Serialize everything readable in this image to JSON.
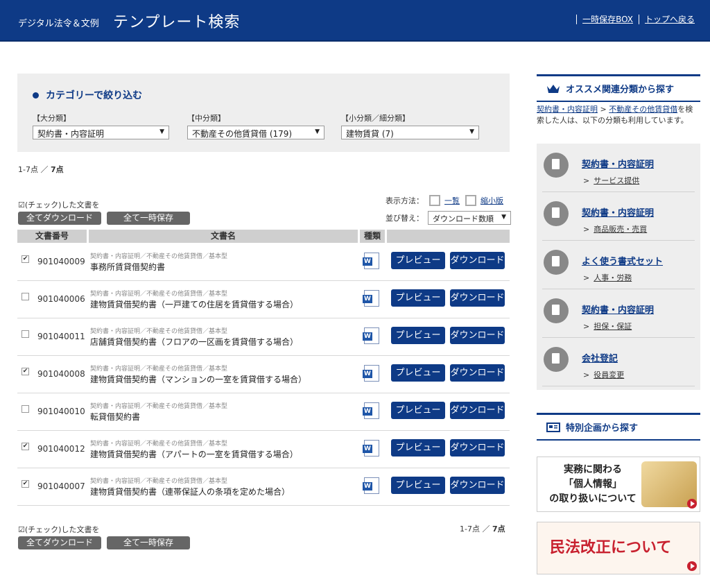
{
  "header": {
    "brand": "デジタル法令＆文例",
    "title": "テンプレート検索",
    "links": [
      "一時保存BOX",
      "トップへ戻る"
    ]
  },
  "filter": {
    "title": "カテゴリーで絞り込む",
    "large": {
      "label": "【大分類】",
      "value": "契約書・内容証明"
    },
    "middle": {
      "label": "【中分類】",
      "value": "不動産その他賃貸借 (179)"
    },
    "small": {
      "label": "【小分類／細分類】",
      "value": "建物賃貸 (7)"
    }
  },
  "count": {
    "range": "1-7点",
    "sep": "／",
    "total": "7点"
  },
  "list": {
    "check_note": "☑(チェック)した文書を",
    "download_all": "全てダウンロード",
    "save_all": "全て一時保存",
    "display_label": "表示方法：",
    "mode_list": "一覧",
    "mode_thumb": "縮小版",
    "sort_label": "並び替え：",
    "sort_value": "ダウンロード数順",
    "headers": {
      "no": "文書番号",
      "name": "文書名",
      "type": "種類"
    },
    "preview_label": "プレビュー",
    "download_label": "ダウンロード",
    "rows": [
      {
        "checked": "✔",
        "no": "901040009",
        "cat": "契約書・内容証明／不動産その他賃貸借／基本型",
        "name": "事務所賃貸借契約書"
      },
      {
        "checked": "",
        "no": "901040006",
        "cat": "契約書・内容証明／不動産その他賃貸借／基本型",
        "name": "建物賃貸借契約書（一戸建ての住居を賃貸借する場合）"
      },
      {
        "checked": "",
        "no": "901040011",
        "cat": "契約書・内容証明／不動産その他賃貸借／基本型",
        "name": "店舗賃貸借契約書（フロアの一区画を賃貸借する場合）"
      },
      {
        "checked": "✔",
        "no": "901040008",
        "cat": "契約書・内容証明／不動産その他賃貸借／基本型",
        "name": "建物賃貸借契約書（マンションの一室を賃貸借する場合）"
      },
      {
        "checked": "",
        "no": "901040010",
        "cat": "契約書・内容証明／不動産その他賃貸借／基本型",
        "name": "転貸借契約書"
      },
      {
        "checked": "✔",
        "no": "901040012",
        "cat": "契約書・内容証明／不動産その他賃貸借／基本型",
        "name": "建物賃貸借契約書（アパートの一室を賃貸借する場合）"
      },
      {
        "checked": "✔",
        "no": "901040007",
        "cat": "契約書・内容証明／不動産その他賃貸借／基本型",
        "name": "建物賃貸借契約書（連帯保証人の条項を定めた場合）"
      }
    ]
  },
  "sidebar": {
    "recommend_title": "オススメ関連分類から探す",
    "desc_link1": "契約書・内容証明",
    "desc_arrow": " > ",
    "desc_link2": "不動産その他賃貸借",
    "desc_text": "を検索した人は、以下の分類も利用しています。",
    "items": [
      {
        "title": "契約書・内容証明",
        "sub": "サービス提供"
      },
      {
        "title": "契約書・内容証明",
        "sub": "商品販売・売買"
      },
      {
        "title": "よく使う書式セット",
        "sub": "人事・労務"
      },
      {
        "title": "契約書・内容証明",
        "sub": "担保・保証"
      },
      {
        "title": "会社登記",
        "sub": "役員変更"
      }
    ],
    "special_title": "特別企画から探す",
    "banner1_line1": "実務に関わる",
    "banner1_line2": "「個人情報」",
    "banner1_line3": "の取り扱いについて",
    "banner2": "民法改正について"
  }
}
